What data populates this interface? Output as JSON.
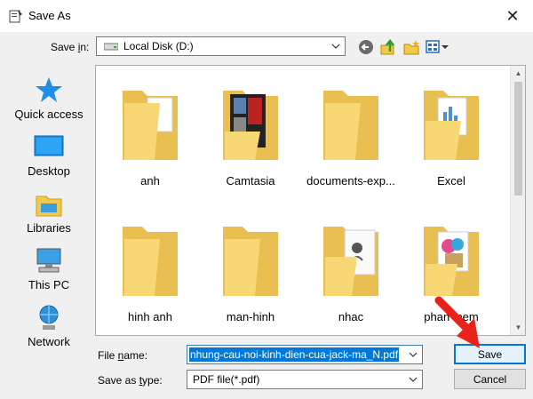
{
  "window": {
    "title": "Save As",
    "close_label": "✕"
  },
  "toolbar": {
    "save_in_label": "Save in:",
    "save_in_value": "Local Disk (D:)"
  },
  "places": [
    {
      "label": "Quick access",
      "icon": "quick-access-star-icon"
    },
    {
      "label": "Desktop",
      "icon": "desktop-icon"
    },
    {
      "label": "Libraries",
      "icon": "libraries-icon"
    },
    {
      "label": "This PC",
      "icon": "this-pc-icon"
    },
    {
      "label": "Network",
      "icon": "network-icon"
    }
  ],
  "folders": [
    {
      "label": "anh"
    },
    {
      "label": "Camtasia"
    },
    {
      "label": "documents-exp..."
    },
    {
      "label": "Excel"
    },
    {
      "label": "hinh anh"
    },
    {
      "label": "man-hinh"
    },
    {
      "label": "nhac"
    },
    {
      "label": "phan mem"
    }
  ],
  "form": {
    "file_name_label": "File name:",
    "file_name_value": "nhung-cau-noi-kinh-dien-cua-jack-ma_N.pdf",
    "save_as_type_label": "Save as type:",
    "save_as_type_value": "PDF file(*.pdf)",
    "save_button": "Save",
    "cancel_button": "Cancel"
  },
  "colors": {
    "selection": "#0078d7",
    "folder": "#f8d775",
    "arrow": "#e8231b"
  }
}
